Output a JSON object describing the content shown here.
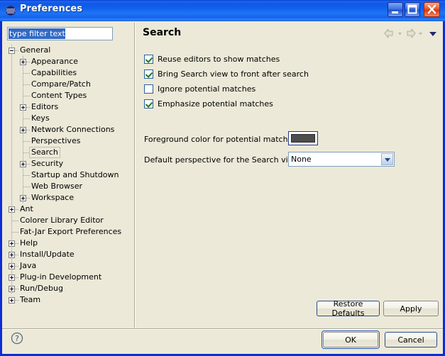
{
  "window": {
    "title": "Preferences",
    "icon": "eclipse-sphere-icon",
    "controls": {
      "minimize": "minimize-button",
      "maximize": "maximize-button",
      "close": "close-button"
    }
  },
  "filter": {
    "value": "type filter text",
    "placeholder": "type filter text"
  },
  "tree": {
    "items": [
      {
        "label": "General",
        "depth": 0,
        "expander": "minus",
        "selected": false
      },
      {
        "label": "Appearance",
        "depth": 1,
        "expander": "plus",
        "selected": false
      },
      {
        "label": "Capabilities",
        "depth": 1,
        "expander": "none",
        "selected": false
      },
      {
        "label": "Compare/Patch",
        "depth": 1,
        "expander": "none",
        "selected": false
      },
      {
        "label": "Content Types",
        "depth": 1,
        "expander": "none",
        "selected": false
      },
      {
        "label": "Editors",
        "depth": 1,
        "expander": "plus",
        "selected": false
      },
      {
        "label": "Keys",
        "depth": 1,
        "expander": "none",
        "selected": false
      },
      {
        "label": "Network Connections",
        "depth": 1,
        "expander": "plus",
        "selected": false
      },
      {
        "label": "Perspectives",
        "depth": 1,
        "expander": "none",
        "selected": false
      },
      {
        "label": "Search",
        "depth": 1,
        "expander": "none",
        "selected": true
      },
      {
        "label": "Security",
        "depth": 1,
        "expander": "plus",
        "selected": false
      },
      {
        "label": "Startup and Shutdown",
        "depth": 1,
        "expander": "none",
        "selected": false
      },
      {
        "label": "Web Browser",
        "depth": 1,
        "expander": "none",
        "selected": false
      },
      {
        "label": "Workspace",
        "depth": 1,
        "expander": "plus",
        "selected": false
      },
      {
        "label": "Ant",
        "depth": 0,
        "expander": "plus",
        "selected": false
      },
      {
        "label": "Colorer Library Editor",
        "depth": 0,
        "expander": "none",
        "selected": false
      },
      {
        "label": "Fat-Jar Export Preferences",
        "depth": 0,
        "expander": "none",
        "selected": false
      },
      {
        "label": "Help",
        "depth": 0,
        "expander": "plus",
        "selected": false
      },
      {
        "label": "Install/Update",
        "depth": 0,
        "expander": "plus",
        "selected": false
      },
      {
        "label": "Java",
        "depth": 0,
        "expander": "plus",
        "selected": false
      },
      {
        "label": "Plug-in Development",
        "depth": 0,
        "expander": "plus",
        "selected": false
      },
      {
        "label": "Run/Debug",
        "depth": 0,
        "expander": "plus",
        "selected": false
      },
      {
        "label": "Team",
        "depth": 0,
        "expander": "plus",
        "selected": false
      }
    ]
  },
  "page": {
    "title": "Search",
    "nav": {
      "back": "back-arrow",
      "forward": "forward-arrow",
      "menu": "view-menu-chevron"
    },
    "checkboxes": [
      {
        "label": "Reuse editors to show matches",
        "checked": true
      },
      {
        "label": "Bring Search view to front after search",
        "checked": true
      },
      {
        "label": "Ignore potential matches",
        "checked": false
      },
      {
        "label": "Emphasize potential matches",
        "checked": true
      }
    ],
    "color_field": {
      "label": "Foreground color for potential matches:",
      "color": "#4d4d4d"
    },
    "perspective_field": {
      "label": "Default perspective for the Search view:",
      "value": "None",
      "options": [
        "None"
      ]
    },
    "buttons": {
      "restore_defaults": "Restore Defaults",
      "apply": "Apply"
    }
  },
  "footer": {
    "help": "help-icon",
    "ok": "OK",
    "cancel": "Cancel"
  },
  "colors": {
    "titlebar_blue": "#1262ee",
    "frame_blue": "#0a2ed4",
    "dialog_bg": "#ece9d8",
    "check_green": "#1a7a1a",
    "selection_blue": "#316ac5"
  }
}
